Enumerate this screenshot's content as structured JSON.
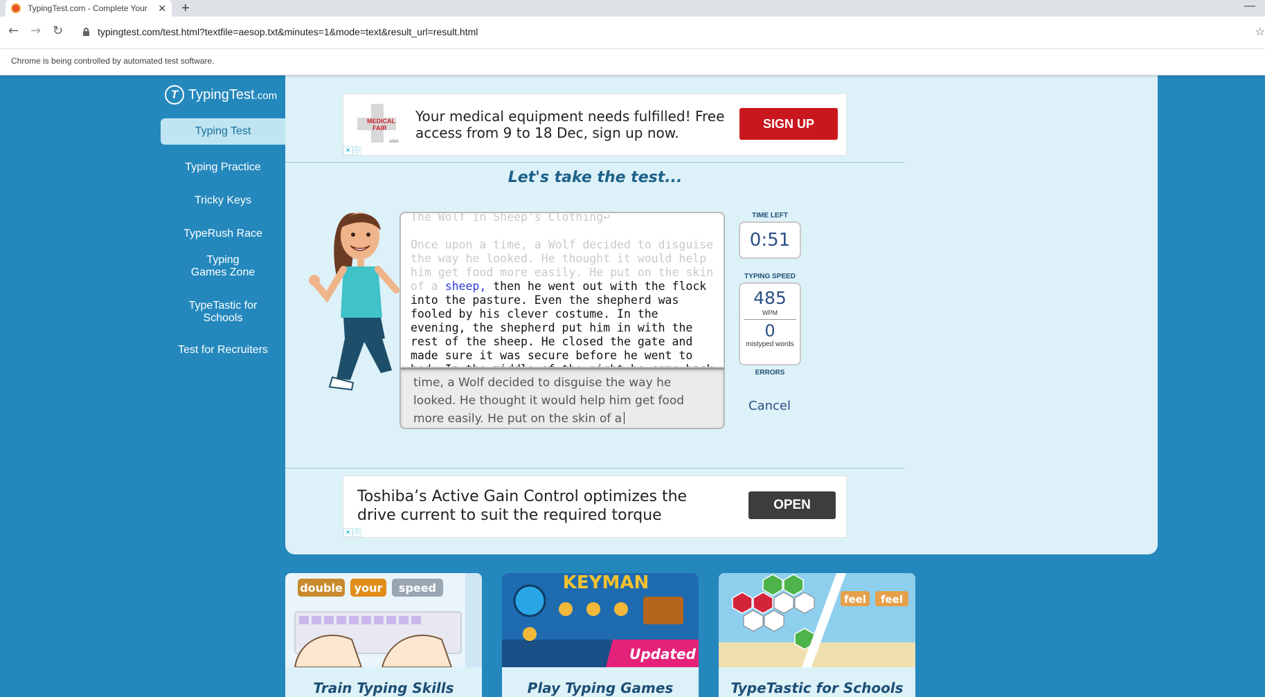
{
  "browser": {
    "tab_title": "TypingTest.com - Complete Your",
    "tab_close": "✕",
    "new_tab": "+",
    "minimize": "—",
    "url": "typingtest.com/test.html?textfile=aesop.txt&minutes=1&mode=text&result_url=result.html",
    "infobar": "Chrome is being controlled by automated test software."
  },
  "logo": {
    "icon": "T",
    "name": "TypingTest",
    "suffix": ".com"
  },
  "sidebar": {
    "items": [
      {
        "label": "Typing Test",
        "active": true
      },
      {
        "label": "Typing Practice"
      },
      {
        "label": "Tricky Keys"
      },
      {
        "label": "TypeRush Race"
      },
      {
        "label": "Typing Games Zone"
      },
      {
        "label": "TypeTastic for Schools"
      },
      {
        "label": "Test for Recruiters"
      }
    ]
  },
  "ads": {
    "top": {
      "logo_text_1": "MEDICAL",
      "logo_text_2": "FAIR",
      "logo_text_3": "ASIA",
      "headline": "Your medical equipment needs fulfilled! Free access from 9 to 18 Dec, sign up now.",
      "cta": "SIGN UP"
    },
    "bottom": {
      "headline": "Toshiba’s Active Gain Control optimizes the drive current to suit the required torque",
      "cta": "OPEN"
    },
    "close_glyph": "✕",
    "info_glyph": "ⓘ"
  },
  "test": {
    "heading": "Let's take the test...",
    "title_line": "The Wolf in Sheep's Clothing↩",
    "typed_part": "Once upon a time, a Wolf decided to disguise the way he looked. He thought it would help him get food more easily. He put on the skin of a",
    "current_word": "sheep,",
    "remaining_text": "then he went out with the flock into the pasture. Even the shepherd was fooled by his clever costume. In the evening, the shepherd put him in with the rest of the sheep. He closed the gate and made sure it was secure before he went to bed. In the middle of the night he came back into the fold to get",
    "input_value": "time, a Wolf decided to disguise the way he looked. He thought it would help him get food more easily. He put on the skin of a"
  },
  "stats": {
    "time_label": "TIME LEFT",
    "time_left": "0:51",
    "speed_label": "TYPING SPEED",
    "wpm": "485",
    "wpm_unit": "WPM",
    "errors": "0",
    "errors_unit": "mistyped words",
    "errors_label": "ERRORS",
    "cancel": "Cancel"
  },
  "tiles": [
    {
      "title": "Train Typing Skills",
      "art_words": [
        "double",
        "your",
        "speed"
      ]
    },
    {
      "title": "Play Typing Games",
      "art_words": [
        "KEYMAN",
        "Updated"
      ]
    },
    {
      "title": "TypeTastic for Schools",
      "art_words": [
        "feel",
        "feel"
      ]
    }
  ],
  "colors": {
    "page_bg": "#2488bd",
    "card_bg": "#ddf1f8",
    "heading": "#1d6289",
    "current_word": "#2a3ad6",
    "signup_btn": "#c9171e",
    "open_btn": "#3d3d3d"
  }
}
